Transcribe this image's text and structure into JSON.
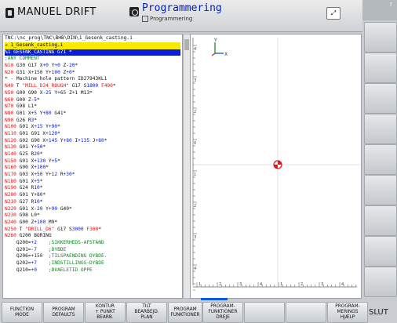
{
  "header": {
    "mode_title": "MANUEL DRIFT",
    "program_title": "Programmering",
    "program_subtitle": "Programmering",
    "top_right_icon": "split-screen-icon"
  },
  "right_column": {
    "top_label": "?"
  },
  "editor": {
    "path": "TNC:\\nc_prog\\TNC\\BHB\\DIN\\1_Gesenk_casting.i",
    "lines": [
      {
        "t": "→ 1_Gesenk_casting.i",
        "k": "sel"
      },
      {
        "t": "%1 GESENK_CASTING G71 *",
        "k": "cur"
      },
      {
        "t": ";ANY COMMENT",
        "k": ""
      },
      {
        "t": "N10 G30 G17 X+0 Y+0 Z-20*",
        "k": ""
      },
      {
        "t": "N20 G31 X+150 Y+100 Z+0*",
        "k": ""
      },
      {
        "t": "* - Machine hole pattern ID27943KL1",
        "k": ""
      },
      {
        "t": "N40 T \"MILL_D24_ROUGH\" G17 S1800 F400*",
        "k": ""
      },
      {
        "t": "N50 G00 G90 X-25 Y+65 Z+1 M13*",
        "k": ""
      },
      {
        "t": "N60 G00 Z-5*",
        "k": ""
      },
      {
        "t": "N70 G98 L1*",
        "k": ""
      },
      {
        "t": "N80 G01 X+5 Y+80 G41*",
        "k": ""
      },
      {
        "t": "N90 G26 R3*",
        "k": ""
      },
      {
        "t": "N100 G01 X+15 Y+90*",
        "k": ""
      },
      {
        "t": "N110 G01 G91 X+120*",
        "k": ""
      },
      {
        "t": "N120 G02 G90 X+145 Y+80 I+135 J+80*",
        "k": ""
      },
      {
        "t": "N130 G01 Y+50*",
        "k": ""
      },
      {
        "t": "N140 G25 R20*",
        "k": ""
      },
      {
        "t": "N150 G01 X+130 Y+5*",
        "k": ""
      },
      {
        "t": "N160 G00 X+100*",
        "k": ""
      },
      {
        "t": "N170 G03 X+50 Y+12 R+30*",
        "k": ""
      },
      {
        "t": "N180 G01 X+5*",
        "k": ""
      },
      {
        "t": "N190 G24 R10*",
        "k": ""
      },
      {
        "t": "N200 G01 Y+80*",
        "k": ""
      },
      {
        "t": "N210 G27 R10*",
        "k": ""
      },
      {
        "t": "N220 G01 X-20 Y+90 G40*",
        "k": ""
      },
      {
        "t": "N230 G98 L0*",
        "k": ""
      },
      {
        "t": "N240 G00 Z+100 M9*",
        "k": ""
      },
      {
        "t": "N250 T \"DRILL_D6\" G17 S3000 F300*",
        "k": ""
      },
      {
        "t": "N260 G200 BORING",
        "k": ""
      },
      {
        "t": "    Q200=+2    ;SIKKERHEDS-AFSTAND",
        "k": ""
      },
      {
        "t": "    Q201=-7    ;DYBDE",
        "k": ""
      },
      {
        "t": "    Q206=+150  ;TILSPAENDING DYBDE.",
        "k": ""
      },
      {
        "t": "    Q202=+7    ;INDSTILLINGS-DYBDE",
        "k": ""
      },
      {
        "t": "    Q210=+0    ;DVAELETID OPPE",
        "k": ""
      }
    ]
  },
  "graphic": {
    "axis_y": "Y",
    "axis_x": "X",
    "ruler_left": [
      "4",
      "3",
      "2",
      "0",
      "1",
      "2",
      "3",
      "4"
    ],
    "ruler_bottom": [
      "1",
      "2",
      "3",
      "4",
      "1",
      "2",
      "3",
      "4"
    ]
  },
  "softkeys": [
    {
      "l1": "FUNCTION",
      "l2": "MODE",
      "l3": ""
    },
    {
      "l1": "PROGRAM",
      "l2": "DEFAULTS",
      "l3": ""
    },
    {
      "l1": "KONTUR",
      "l2": "+ PUNKT",
      "l3": "BEARB."
    },
    {
      "l1": "TILT",
      "l2": "BEARBEJD.",
      "l3": "PLAN"
    },
    {
      "l1": "PROGRAM",
      "l2": "FUNKTIONER",
      "l3": ""
    },
    {
      "l1": "PROGRAM-",
      "l2": "FUNKTIONER",
      "l3": "DREJE"
    },
    {
      "l1": "",
      "l2": "",
      "l3": ""
    },
    {
      "l1": "",
      "l2": "",
      "l3": ""
    },
    {
      "l1": "PROGRAM-",
      "l2": "MERINGS",
      "l3": "HJÆLP"
    }
  ],
  "end_key": "SLUT"
}
